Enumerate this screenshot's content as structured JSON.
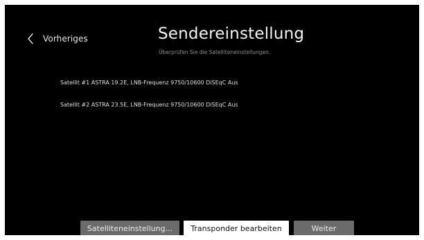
{
  "header": {
    "back_label": "Vorheriges",
    "back_icon": "chevron-left-icon",
    "title": "Sendereinstellung",
    "subtitle": "Überprüfen Sie die Satelliteneinstellungen."
  },
  "satellites": [
    {
      "text": "Satellit #1 ASTRA 19.2E, LNB-Frequenz 9750/10600 DiSEqC Aus"
    },
    {
      "text": "Satellit #2 ASTRA 23.5E, LNB-Frequenz 9750/10600 DiSEqC Aus"
    }
  ],
  "buttons": {
    "satellite_settings": "Satelliteneinstellung...",
    "edit_transponder": "Transponder bearbeiten",
    "next": "Weiter"
  },
  "focused_button": "edit_transponder",
  "colors": {
    "background": "#000000",
    "button_default": "#6b6b6b",
    "button_focused": "#ffffff"
  }
}
